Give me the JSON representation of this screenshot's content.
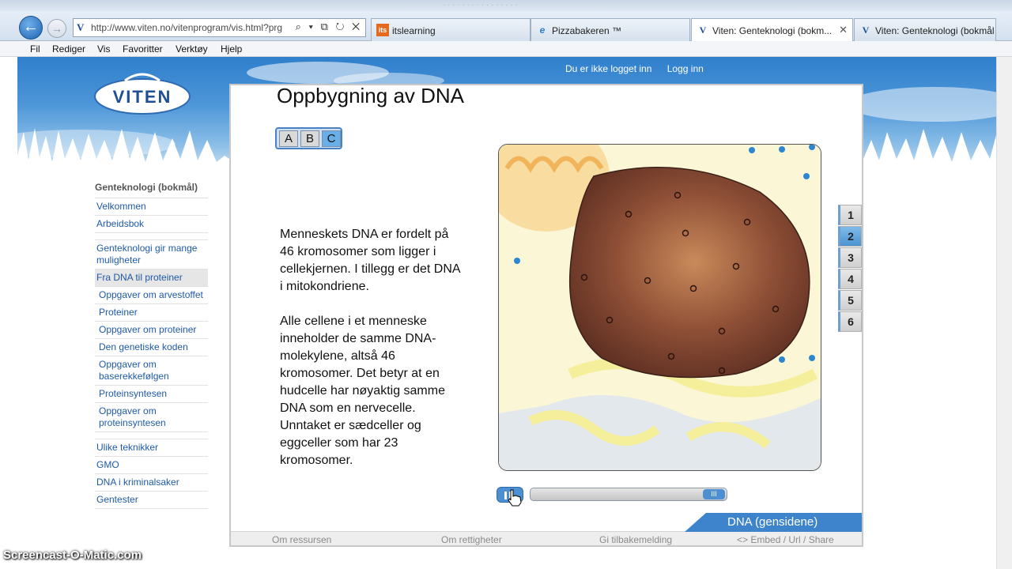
{
  "browser": {
    "url": "http://www.viten.no/vitenprogram/vis.html?prg",
    "address_favicon": "V",
    "address_tools": "⌕ ▾ ⧉ ↻ ✕",
    "menu": [
      "Fil",
      "Rediger",
      "Vis",
      "Favoritter",
      "Verktøy",
      "Hjelp"
    ],
    "tabs": [
      {
        "icon": "its",
        "label": "itslearning"
      },
      {
        "icon": "e",
        "label": "Pizzabakeren ™"
      },
      {
        "icon": "V",
        "label": "Viten: Genteknologi (bokm..."
      },
      {
        "icon": "V",
        "label": "Viten: Genteknologi (bokmål"
      }
    ]
  },
  "site": {
    "logo": "VITEN",
    "status": "Du er ikke logget inn",
    "login": "Logg inn"
  },
  "sidebar": {
    "title": "Genteknologi (bokmål)",
    "items": [
      {
        "label": "Velkommen"
      },
      {
        "label": "Arbeidsbok"
      },
      {
        "label": "Genteknologi gir mange muligheter"
      },
      {
        "label": "Fra DNA til proteiner"
      },
      {
        "label": "Oppgaver om arvestoffet"
      },
      {
        "label": "Proteiner"
      },
      {
        "label": "Oppgaver om proteiner"
      },
      {
        "label": "Den genetiske koden"
      },
      {
        "label": "Oppgaver om baserekkefølgen"
      },
      {
        "label": "Proteinsyntesen"
      },
      {
        "label": "Oppgaver om proteinsyntesen"
      },
      {
        "label": "Ulike teknikker"
      },
      {
        "label": "GMO"
      },
      {
        "label": "DNA i kriminalsaker"
      },
      {
        "label": "Gentester"
      }
    ]
  },
  "content": {
    "heading": "Oppbygning av DNA",
    "level_tabs": [
      "A",
      "B",
      "C"
    ],
    "active_level": "C",
    "paragraph1": "Menneskets DNA er fordelt på 46 kromosomer som ligger i cellekjernen. I tillegg er det DNA i mitokondriene.",
    "paragraph2": "Alle cellene i et menneske inneholder de samme DNA-molekylene, altså 46 kromosomer. Det betyr at en hudcelle har nøyaktig samme DNA som en nervecelle. Unntaket er sædceller og eggceller som har 23 kromosomer.",
    "page_buttons": [
      "1",
      "2",
      "3",
      "4",
      "5",
      "6"
    ],
    "active_page": "2",
    "slider_thumb": "III",
    "section_tab": "DNA  (gensidene)",
    "footer": [
      "Om ressursen",
      "Om rettigheter",
      "Gi tilbakemelding",
      "<> Embed / Url / Share"
    ]
  },
  "watermark": "Screencast-O-Matic.com"
}
